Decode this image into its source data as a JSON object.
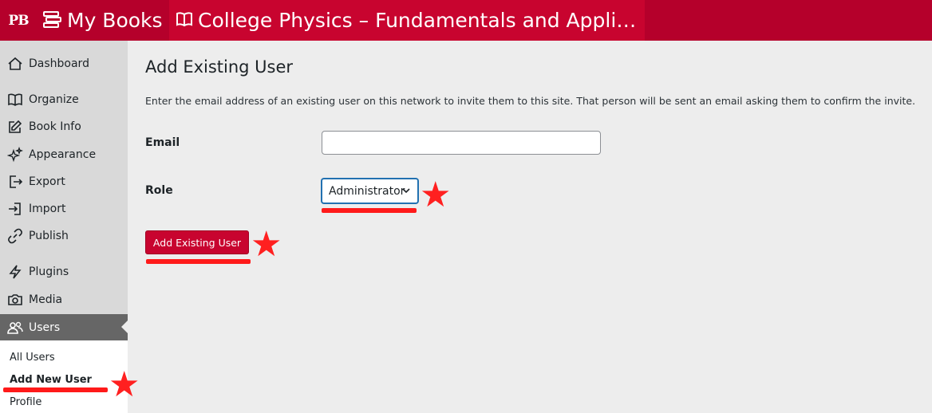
{
  "topbar": {
    "logo": "PB",
    "my_books": "My Books",
    "book_title": "College Physics – Fundamentals and Applications"
  },
  "sidebar": {
    "items": [
      {
        "label": "Dashboard",
        "icon": "home-icon"
      },
      {
        "label": "Organize",
        "icon": "book-open-icon"
      },
      {
        "label": "Book Info",
        "icon": "edit-icon"
      },
      {
        "label": "Appearance",
        "icon": "sparkle-icon"
      },
      {
        "label": "Export",
        "icon": "export-icon"
      },
      {
        "label": "Import",
        "icon": "import-icon"
      },
      {
        "label": "Publish",
        "icon": "link-icon"
      },
      {
        "label": "Plugins",
        "icon": "bolt-icon"
      },
      {
        "label": "Media",
        "icon": "camera-icon"
      },
      {
        "label": "Users",
        "icon": "users-icon"
      }
    ],
    "active": "Users",
    "submenu": [
      "All Users",
      "Add New User",
      "Profile"
    ],
    "submenu_current": "Add New User"
  },
  "main": {
    "title": "Add Existing User",
    "description": "Enter the email address of an existing user on this network to invite them to this site. That person will be sent an email asking them to confirm the invite.",
    "email_label": "Email",
    "email_value": "",
    "role_label": "Role",
    "role_value": "Administrator",
    "submit_label": "Add Existing User"
  },
  "colors": {
    "brand": "#b5002b",
    "annotation": "#ff1a1a"
  }
}
